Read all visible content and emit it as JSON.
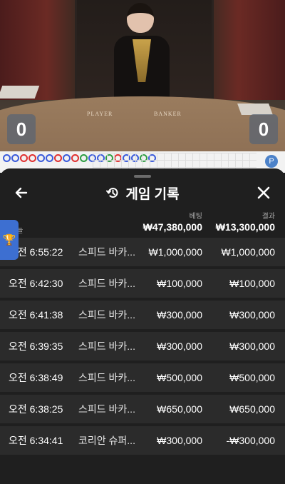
{
  "video": {
    "player_label": "PLAYER",
    "banker_label": "BANKER",
    "player_score": "0",
    "banker_score": "0"
  },
  "roads": {
    "badge": "P",
    "beads": [
      "blue",
      "blue",
      "red",
      "red",
      "blue",
      "blue",
      "red",
      "blue",
      "red",
      "green",
      "blue",
      "blue",
      "green",
      "red",
      "blue",
      "blue",
      "green",
      "blue"
    ]
  },
  "panel": {
    "title": "게임 기록",
    "back_icon": "arrow-left-icon",
    "close_icon": "close-icon",
    "history_icon": "history-icon",
    "bet_header": "베팅",
    "result_header": "결과",
    "today_label": "오늘",
    "total_bet": "₩47,380,000",
    "total_result": "₩13,300,000"
  },
  "rows": [
    {
      "time": "오전 6:55:22",
      "game": "스피드 바카...",
      "bet": "₩1,000,000",
      "result": "₩1,000,000"
    },
    {
      "time": "오전 6:42:30",
      "game": "스피드 바카...",
      "bet": "₩100,000",
      "result": "₩100,000"
    },
    {
      "time": "오전 6:41:38",
      "game": "스피드 바카...",
      "bet": "₩300,000",
      "result": "₩300,000"
    },
    {
      "time": "오전 6:39:35",
      "game": "스피드 바카...",
      "bet": "₩300,000",
      "result": "₩300,000"
    },
    {
      "time": "오전 6:38:49",
      "game": "스피드 바카...",
      "bet": "₩500,000",
      "result": "₩500,000"
    },
    {
      "time": "오전 6:38:25",
      "game": "스피드 바카...",
      "bet": "₩650,000",
      "result": "₩650,000"
    },
    {
      "time": "오전 6:34:41",
      "game": "코리안 슈퍼...",
      "bet": "₩300,000",
      "result": "-₩300,000"
    }
  ],
  "colors": {
    "panel_bg": "#1f1f1f",
    "row_bg": "#2b2b2b",
    "tab_blue": "#3d6fd1"
  }
}
